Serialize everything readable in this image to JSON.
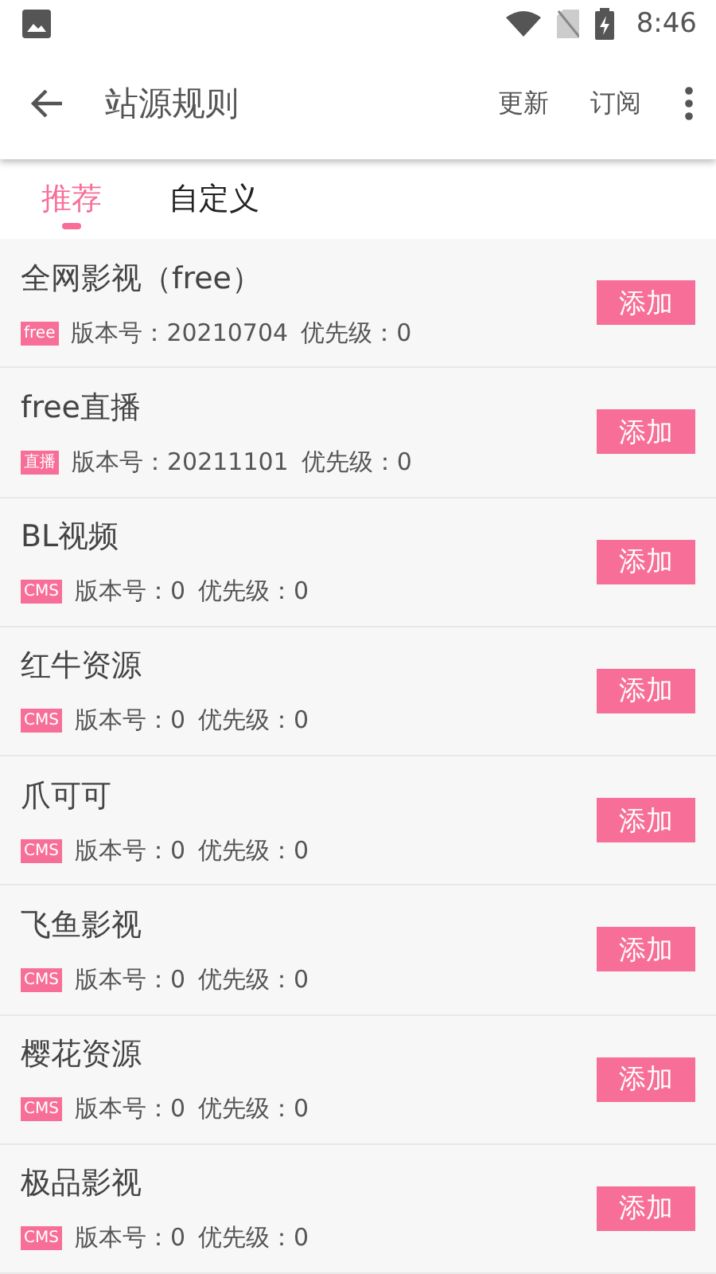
{
  "status_bar": {
    "time": "8:46"
  },
  "toolbar": {
    "title": "站源规则",
    "actions": [
      "更新",
      "订阅"
    ]
  },
  "tabs": [
    {
      "label": "推荐",
      "selected": true
    },
    {
      "label": "自定义",
      "selected": false
    }
  ],
  "rules": [
    {
      "name": "全网影视（free）",
      "tag": "free",
      "version_label": "版本号：20210704",
      "priority_label": "优先级：0",
      "button": "添加"
    },
    {
      "name": "free直播",
      "tag": "直播",
      "version_label": "版本号：20211101",
      "priority_label": "优先级：0",
      "button": "添加"
    },
    {
      "name": "BL视频",
      "tag": "CMS",
      "version_label": "版本号：0",
      "priority_label": "优先级：0",
      "button": "添加"
    },
    {
      "name": "红牛资源",
      "tag": "CMS",
      "version_label": "版本号：0",
      "priority_label": "优先级：0",
      "button": "添加"
    },
    {
      "name": "爪可可",
      "tag": "CMS",
      "version_label": "版本号：0",
      "priority_label": "优先级：0",
      "button": "添加"
    },
    {
      "name": "飞鱼影视",
      "tag": "CMS",
      "version_label": "版本号：0",
      "priority_label": "优先级：0",
      "button": "添加"
    },
    {
      "name": "樱花资源",
      "tag": "CMS",
      "version_label": "版本号：0",
      "priority_label": "优先级：0",
      "button": "添加"
    },
    {
      "name": "极品影视",
      "tag": "CMS",
      "version_label": "版本号：0",
      "priority_label": "优先级：0",
      "button": "添加"
    }
  ]
}
